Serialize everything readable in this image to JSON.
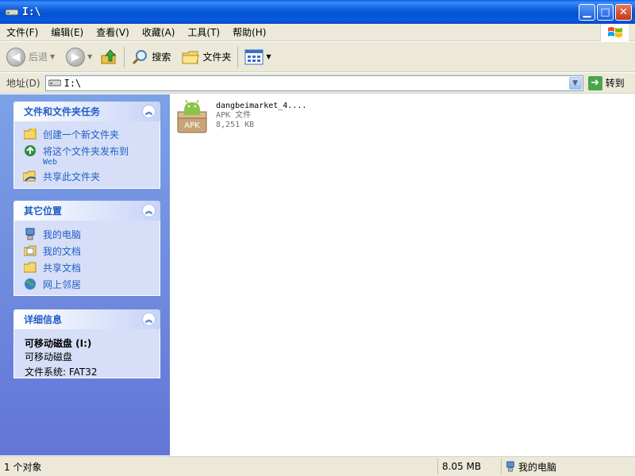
{
  "window": {
    "title": "I:\\"
  },
  "menu": [
    "文件(F)",
    "编辑(E)",
    "查看(V)",
    "收藏(A)",
    "工具(T)",
    "帮助(H)"
  ],
  "toolbar": {
    "back": "后退",
    "search": "搜索",
    "folders": "文件夹"
  },
  "address": {
    "label": "地址(D)",
    "value": "I:\\",
    "go": "转到"
  },
  "tasks": {
    "title": "文件和文件夹任务",
    "items": [
      {
        "label": "创建一个新文件夹"
      },
      {
        "label": "将这个文件夹发布到",
        "sub": "Web"
      },
      {
        "label": "共享此文件夹"
      }
    ]
  },
  "places": {
    "title": "其它位置",
    "items": [
      "我的电脑",
      "我的文档",
      "共享文档",
      "网上邻居"
    ]
  },
  "details": {
    "title": "详细信息",
    "name": "可移动磁盘 (I:)",
    "type": "可移动磁盘",
    "fs": "文件系统: FAT32"
  },
  "file": {
    "name": "dangbeimarket_4....",
    "type": "APK 文件",
    "size": "8,251 KB",
    "icon_text": "APK"
  },
  "status": {
    "count": "1 个对象",
    "size": "8.05 MB",
    "location": "我的电脑"
  },
  "colors": {
    "taskpane_link": "#215dc6",
    "titlebar": "#0553d3",
    "android_green": "#8bc34a"
  }
}
